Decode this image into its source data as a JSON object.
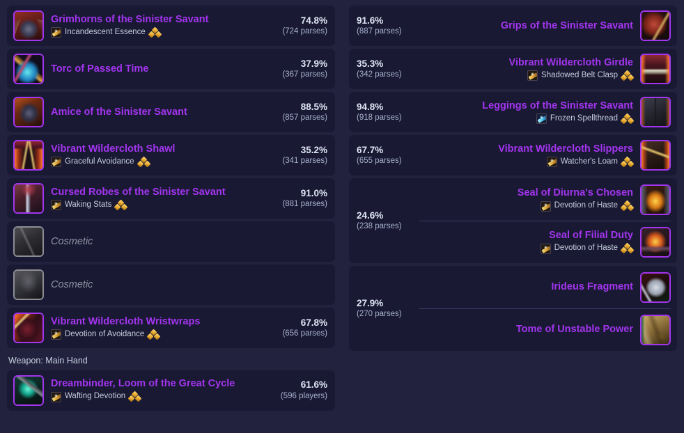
{
  "colors": {
    "page_background": "#22223f",
    "row_background": "#191934",
    "epic_item": "#a335ee",
    "percent_text": "#dfe6f4",
    "parses_text": "#a8b2cc",
    "cosmetic_text": "#9094a3",
    "divider": "#3b3a63"
  },
  "left_column": {
    "rows": [
      {
        "type": "item",
        "icon": "helm-icon",
        "name": "Grimhorns of the Sinister Savant",
        "enchant": "Incandescent Essence",
        "enchant_icon": "enchant-scroll-icon",
        "gem_icon": "gem-cluster-icon",
        "percent": "74.8%",
        "parses": "(724 parses)"
      },
      {
        "type": "item",
        "icon": "neck-icon",
        "name": "Torc of Passed Time",
        "enchant": null,
        "percent": "37.9%",
        "parses": "(367 parses)"
      },
      {
        "type": "item",
        "icon": "shoulder-icon",
        "name": "Amice of the Sinister Savant",
        "enchant": null,
        "percent": "88.5%",
        "parses": "(857 parses)"
      },
      {
        "type": "item",
        "icon": "back-icon",
        "name": "Vibrant Wildercloth Shawl",
        "enchant": "Graceful Avoidance",
        "enchant_icon": "enchant-scroll-icon",
        "gem_icon": "gem-cluster-icon",
        "percent": "35.2%",
        "parses": "(341 parses)"
      },
      {
        "type": "item",
        "icon": "chest-icon",
        "name": "Cursed Robes of the Sinister Savant",
        "enchant": "Waking Stats",
        "enchant_icon": "enchant-scroll-icon",
        "gem_icon": "gem-cluster-icon",
        "percent": "91.0%",
        "parses": "(881 parses)"
      },
      {
        "type": "cosmetic",
        "icon": "cosmetic-shirt-icon",
        "name": "Cosmetic"
      },
      {
        "type": "cosmetic",
        "icon": "cosmetic-tabard-icon",
        "name": "Cosmetic"
      },
      {
        "type": "item",
        "icon": "wrist-icon",
        "name": "Vibrant Wildercloth Wristwraps",
        "enchant": "Devotion of Avoidance",
        "enchant_icon": "enchant-scroll-icon",
        "gem_icon": "gem-cluster-icon",
        "percent": "67.8%",
        "parses": "(656 parses)"
      }
    ],
    "section_header": "Weapon: Main Hand",
    "weapon_row": {
      "type": "item",
      "icon": "staff-icon",
      "name": "Dreambinder, Loom of the Great Cycle",
      "enchant": "Wafting Devotion",
      "enchant_icon": "enchant-scroll-icon",
      "gem_icon": "gem-cluster-icon",
      "percent": "61.6%",
      "parses": "(596 players)"
    }
  },
  "right_column": {
    "rows": [
      {
        "type": "item",
        "icon": "gloves-icon",
        "name": "Grips of the Sinister Savant",
        "enchant": null,
        "percent": "91.6%",
        "parses": "(887 parses)"
      },
      {
        "type": "item",
        "icon": "belt-icon",
        "name": "Vibrant Wildercloth Girdle",
        "enchant": "Shadowed Belt Clasp",
        "enchant_icon": "enchant-scroll-icon",
        "gem_icon": "gem-cluster-icon",
        "percent": "35.3%",
        "parses": "(342 parses)"
      },
      {
        "type": "item",
        "icon": "legs-icon",
        "name": "Leggings of the Sinister Savant",
        "enchant": "Frozen Spellthread",
        "enchant_icon": "enchant-frost-icon",
        "gem_icon": "gem-cluster-icon",
        "percent": "94.8%",
        "parses": "(918 parses)"
      },
      {
        "type": "item",
        "icon": "boots-icon",
        "name": "Vibrant Wildercloth Slippers",
        "enchant": "Watcher's Loam",
        "enchant_icon": "enchant-scroll-icon",
        "gem_icon": "gem-cluster-icon",
        "percent": "67.7%",
        "parses": "(655 parses)"
      },
      {
        "type": "group",
        "percent": "24.6%",
        "parses": "(238 parses)",
        "items": [
          {
            "icon": "ring-diurna-icon",
            "name": "Seal of Diurna's Chosen",
            "enchant": "Devotion of Haste",
            "enchant_icon": "enchant-scroll-icon",
            "gem_icon": "gem-cluster-icon"
          },
          {
            "icon": "ring-filial-icon",
            "name": "Seal of Filial Duty",
            "enchant": "Devotion of Haste",
            "enchant_icon": "enchant-scroll-icon",
            "gem_icon": "gem-cluster-icon"
          }
        ]
      },
      {
        "type": "group",
        "percent": "27.9%",
        "parses": "(270 parses)",
        "items": [
          {
            "icon": "trinket-irideus-icon",
            "name": "Irideus Fragment",
            "enchant": null
          },
          {
            "icon": "trinket-tome-icon",
            "name": "Tome of Unstable Power",
            "enchant": null
          }
        ]
      }
    ]
  }
}
